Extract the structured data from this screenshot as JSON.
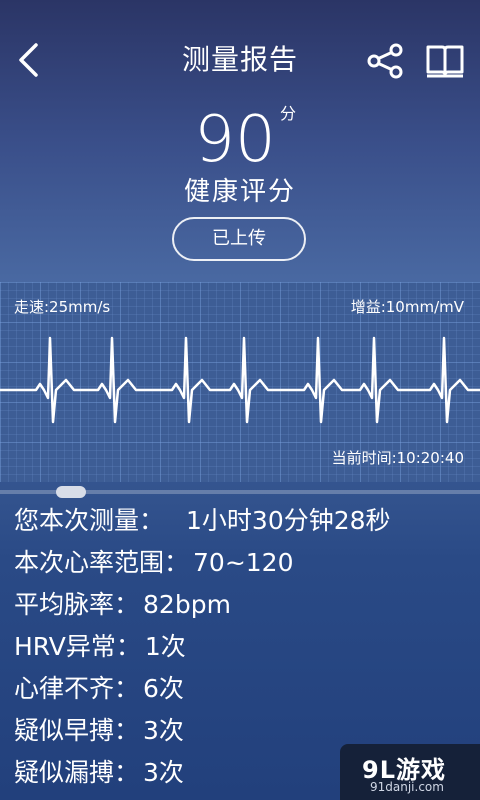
{
  "header": {
    "title": "测量报告",
    "back_icon": "chevron-left-icon",
    "share_icon": "share-icon",
    "book_icon": "book-icon"
  },
  "score": {
    "value": "90",
    "unit": "分",
    "label": "健康评分"
  },
  "upload_status": "已上传",
  "ecg": {
    "speed": "走速:25mm/s",
    "gain": "增益:10mm/mV",
    "current_time": "当前时间:10:20:40"
  },
  "stats": [
    {
      "label": "您本次测量：",
      "value": "1小时30分钟28秒"
    },
    {
      "label": "本次心率范围：",
      "value": "70~120"
    },
    {
      "label": "平均脉率：",
      "value": "82bpm"
    },
    {
      "label": "HRV异常：",
      "value": "1次"
    },
    {
      "label": "心律不齐：",
      "value": "6次"
    },
    {
      "label": "疑似早搏：",
      "value": "3次"
    },
    {
      "label": "疑似漏搏：",
      "value": "3次"
    }
  ],
  "watermark": {
    "logo": "9L游戏",
    "url": "91danji.com"
  },
  "colors": {
    "background_top": "#2b3566",
    "background_bottom": "#22407c",
    "ecg_grid": "#3d5d95",
    "text": "#ffffff"
  }
}
